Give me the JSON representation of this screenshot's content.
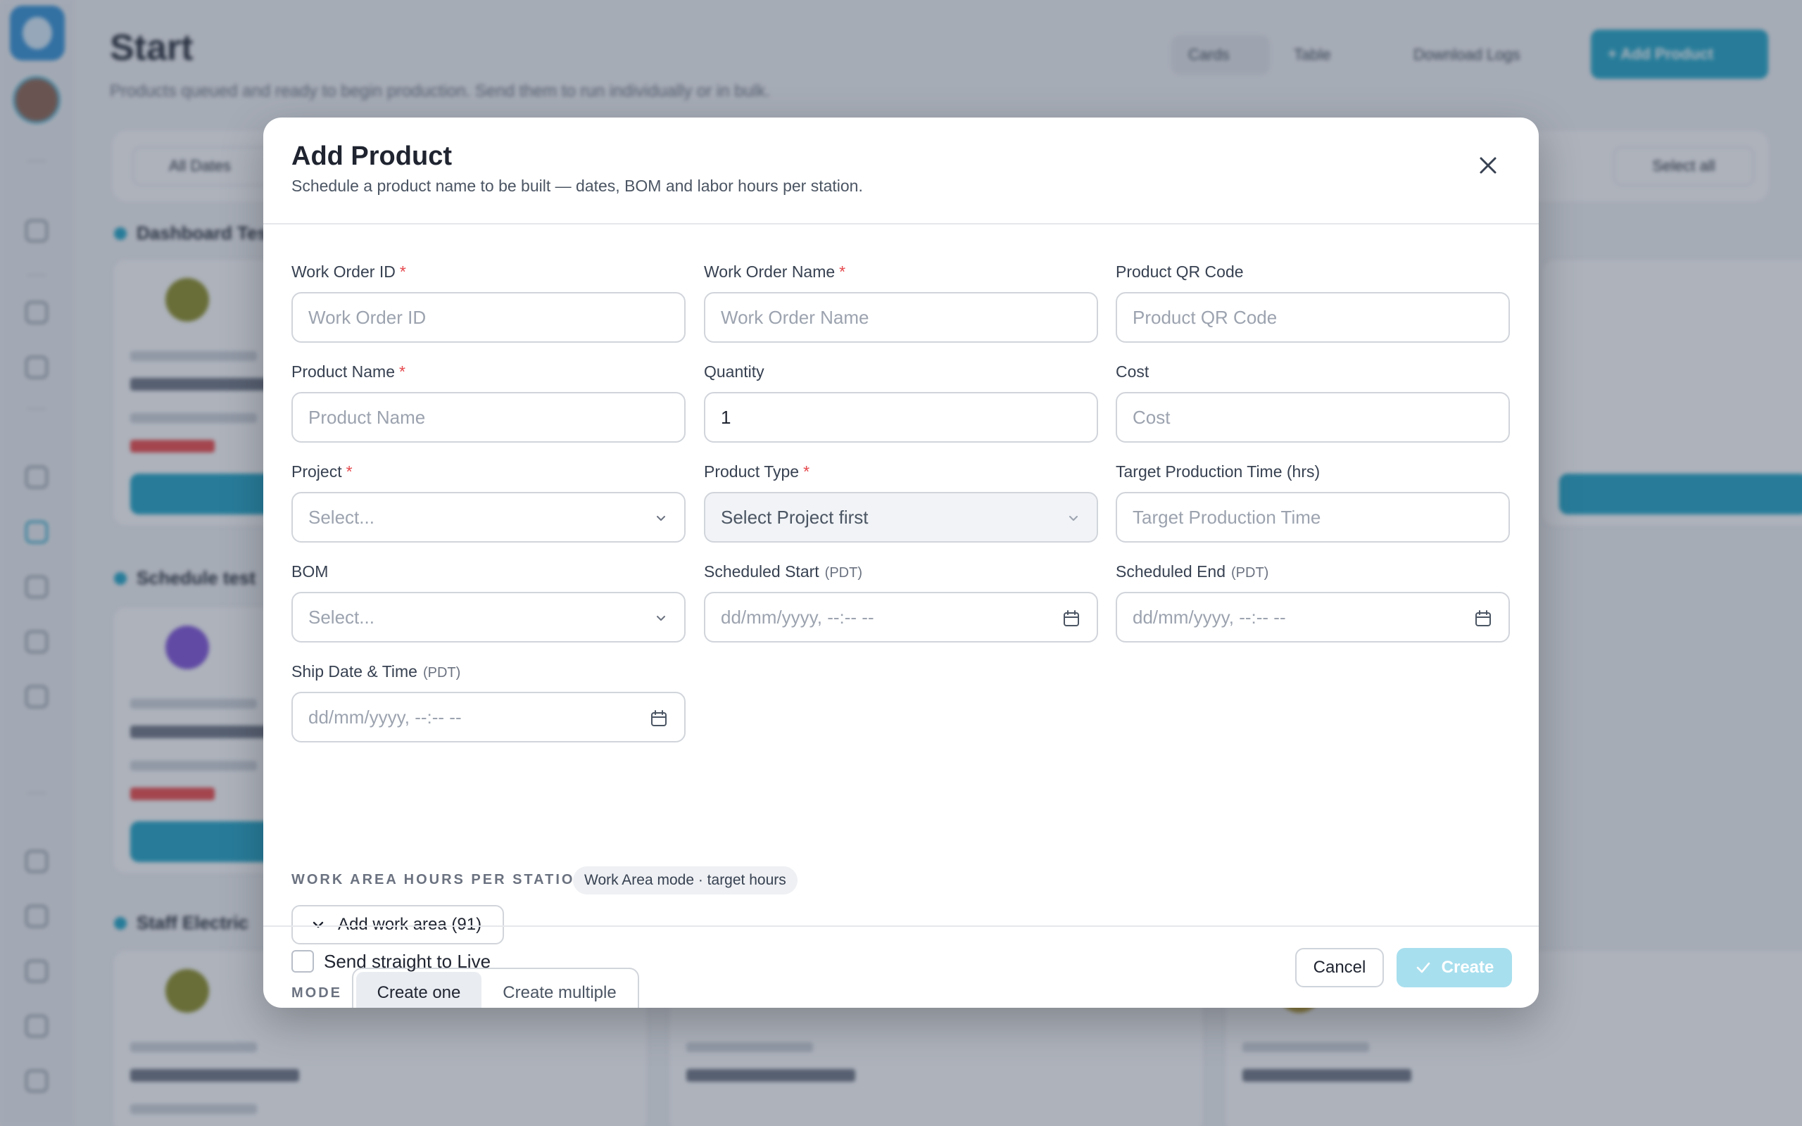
{
  "background": {
    "page_title": "Start",
    "page_subtitle": "Products queued and ready to begin production. Send them to run individually or in bulk.",
    "toolbar": {
      "cards": "Cards",
      "table": "Table",
      "logs": "Download Logs",
      "add": "+  Add Product"
    },
    "filters": {
      "dates": "All Dates",
      "select_all": "Select all"
    },
    "sections": [
      "Dashboard Test",
      "Schedule test",
      "Staff Electric"
    ]
  },
  "modal": {
    "title": "Add Product",
    "subtitle": "Schedule a product name to be built — dates, BOM and labor hours per station.",
    "fields": {
      "work_order_id": {
        "label": "Work Order ID",
        "placeholder": "Work Order ID"
      },
      "work_order_name": {
        "label": "Work Order Name",
        "placeholder": "Work Order Name"
      },
      "product_qr": {
        "label": "Product QR Code",
        "placeholder": "Product QR Code"
      },
      "product_name": {
        "label": "Product Name",
        "placeholder": "Product Name"
      },
      "quantity": {
        "label": "Quantity",
        "value": "1"
      },
      "cost": {
        "label": "Cost",
        "placeholder": "Cost"
      },
      "project": {
        "label": "Project",
        "value": "Select..."
      },
      "product_type": {
        "label": "Product Type",
        "value": "Select Project first"
      },
      "target_time": {
        "label": "Target Production Time (hrs)",
        "placeholder": "Target Production Time"
      },
      "bom": {
        "label": "BOM",
        "value": "Select..."
      },
      "scheduled_start": {
        "label": "Scheduled Start",
        "tz": "(PDT)",
        "placeholder": "dd/mm/yyyy, --:-- --"
      },
      "scheduled_end": {
        "label": "Scheduled End",
        "tz": "(PDT)",
        "placeholder": "dd/mm/yyyy, --:-- --"
      },
      "ship_date": {
        "label": "Ship Date & Time",
        "tz": "(PDT)",
        "placeholder": "dd/mm/yyyy, --:-- --"
      }
    },
    "required_mark": "*",
    "work_area": {
      "label": "WORK AREA HOURS PER STATION",
      "badge": "Work Area mode · target hours",
      "add_button": "Add work area (91)"
    },
    "mode": {
      "label": "MODE",
      "options": [
        "Create one",
        "Create multiple"
      ],
      "selected": "Create one"
    },
    "footer": {
      "send_live_label": "Send straight to Live",
      "send_live_checked": false,
      "cancel": "Cancel",
      "create": "Create"
    }
  },
  "colors": {
    "accent": "#1aa3c6",
    "create_disabled": "#a8dfee",
    "required": "#e5484d",
    "late": "#ef4444"
  }
}
